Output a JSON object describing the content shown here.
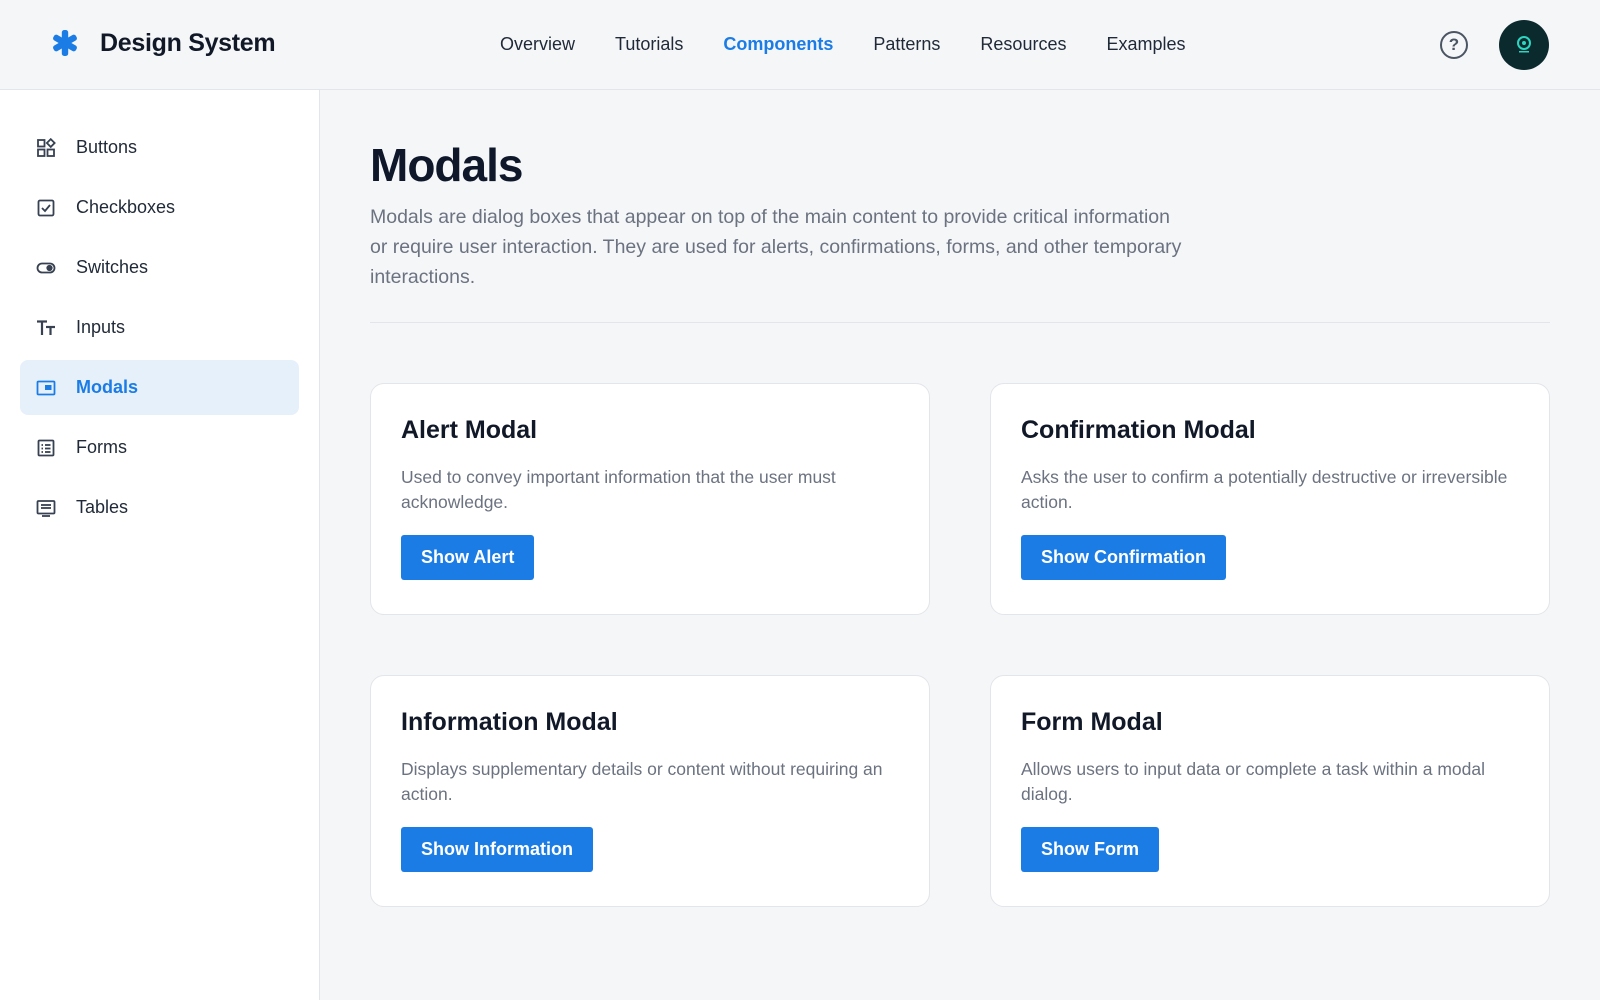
{
  "header": {
    "brand_name": "Design System",
    "brand_icon": "asterisk-icon",
    "nav": [
      {
        "label": "Overview",
        "active": false
      },
      {
        "label": "Tutorials",
        "active": false
      },
      {
        "label": "Components",
        "active": true
      },
      {
        "label": "Patterns",
        "active": false
      },
      {
        "label": "Resources",
        "active": false
      },
      {
        "label": "Examples",
        "active": false
      }
    ],
    "help_icon": "help-circle-icon",
    "help_glyph": "?",
    "avatar_icon": "user-avatar"
  },
  "sidebar": {
    "items": [
      {
        "label": "Buttons",
        "icon": "grid-shapes-icon",
        "active": false
      },
      {
        "label": "Checkboxes",
        "icon": "checkbox-icon",
        "active": false
      },
      {
        "label": "Switches",
        "icon": "toggle-icon",
        "active": false
      },
      {
        "label": "Inputs",
        "icon": "text-icon",
        "active": false
      },
      {
        "label": "Modals",
        "icon": "modal-window-icon",
        "active": true
      },
      {
        "label": "Forms",
        "icon": "form-list-icon",
        "active": false
      },
      {
        "label": "Tables",
        "icon": "table-icon",
        "active": false
      }
    ]
  },
  "main": {
    "title": "Modals",
    "description": "Modals are dialog boxes that appear on top of the main content to provide critical information or require user interaction. They are used for alerts, confirmations, forms, and other temporary interactions.",
    "cards": [
      {
        "title": "Alert Modal",
        "description": "Used to convey important information that the user must acknowledge.",
        "button": "Show Alert"
      },
      {
        "title": "Confirmation Modal",
        "description": "Asks the user to confirm a potentially destructive or irreversible action.",
        "button": "Show Confirmation"
      },
      {
        "title": "Information Modal",
        "description": "Displays supplementary details or content without requiring an action.",
        "button": "Show Information"
      },
      {
        "title": "Form Modal",
        "description": "Allows users to input data or complete a task within a modal dialog.",
        "button": "Show Form"
      }
    ]
  },
  "colors": {
    "accent": "#1b7ce6",
    "active_bg": "#e6f0fb",
    "page_bg": "#f5f6f8",
    "avatar_bg": "#0b2a2e"
  }
}
